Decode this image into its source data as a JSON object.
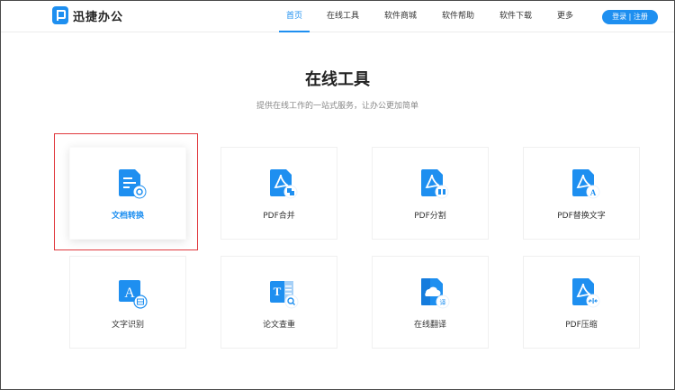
{
  "logo": {
    "text": "迅捷办公"
  },
  "nav": {
    "items": [
      {
        "label": "首页",
        "active": true
      },
      {
        "label": "在线工具",
        "active": false
      },
      {
        "label": "软件商城",
        "active": false
      },
      {
        "label": "软件帮助",
        "active": false
      },
      {
        "label": "软件下载",
        "active": false
      },
      {
        "label": "更多",
        "active": false
      }
    ],
    "login_label": "登录 | 注册"
  },
  "main": {
    "title": "在线工具",
    "subtitle": "提供在线工作的一站式服务，让办公更加简单",
    "tools": [
      {
        "label": "文档转换",
        "icon": "document-convert-icon",
        "featured": true
      },
      {
        "label": "PDF合并",
        "icon": "pdf-merge-icon",
        "featured": false
      },
      {
        "label": "PDF分割",
        "icon": "pdf-split-icon",
        "featured": false
      },
      {
        "label": "PDF替换文字",
        "icon": "pdf-replace-text-icon",
        "featured": false
      },
      {
        "label": "文字识别",
        "icon": "text-recognition-icon",
        "featured": false
      },
      {
        "label": "论文查重",
        "icon": "paper-check-icon",
        "featured": false
      },
      {
        "label": "在线翻译",
        "icon": "online-translate-icon",
        "featured": false
      },
      {
        "label": "PDF压缩",
        "icon": "pdf-compress-icon",
        "featured": false
      }
    ]
  },
  "colors": {
    "accent": "#1e8ff0",
    "highlight": "#e0393e"
  }
}
